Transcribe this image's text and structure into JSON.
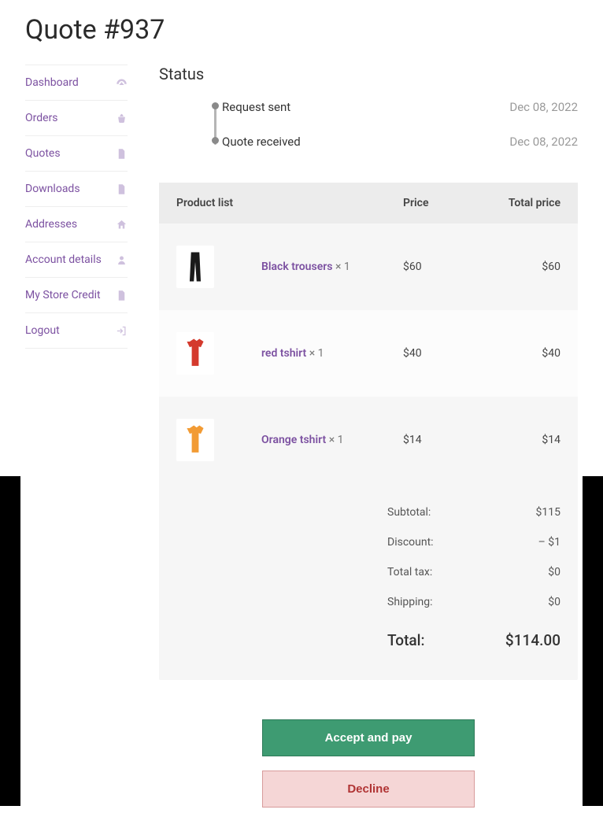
{
  "page_title": "Quote #937",
  "sidebar": {
    "items": [
      {
        "label": "Dashboard",
        "icon": "gauge-icon"
      },
      {
        "label": "Orders",
        "icon": "basket-icon"
      },
      {
        "label": "Quotes",
        "icon": "file-icon"
      },
      {
        "label": "Downloads",
        "icon": "file-icon"
      },
      {
        "label": "Addresses",
        "icon": "home-icon"
      },
      {
        "label": "Account details",
        "icon": "user-icon"
      },
      {
        "label": "My Store Credit",
        "icon": "file-icon"
      },
      {
        "label": "Logout",
        "icon": "logout-icon"
      }
    ]
  },
  "status": {
    "heading": "Status",
    "events": [
      {
        "label": "Request sent",
        "date": "Dec 08, 2022"
      },
      {
        "label": "Quote received",
        "date": "Dec 08, 2022"
      }
    ]
  },
  "products": {
    "headers": {
      "product": "Product list",
      "price": "Price",
      "total": "Total price"
    },
    "items": [
      {
        "name": "Black trousers",
        "qty": "× 1",
        "price": "$60",
        "total": "$60",
        "color": "#1a1a1a",
        "kind": "trousers"
      },
      {
        "name": "red tshirt",
        "qty": "× 1",
        "price": "$40",
        "total": "$40",
        "color": "#d43a2d",
        "kind": "tshirt"
      },
      {
        "name": "Orange tshirt",
        "qty": "× 1",
        "price": "$14",
        "total": "$14",
        "color": "#f29b34",
        "kind": "tshirt"
      }
    ]
  },
  "totals": {
    "rows": [
      {
        "label": "Subtotal:",
        "value": "$115"
      },
      {
        "label": "Discount:",
        "value": "– $1"
      },
      {
        "label": "Total tax:",
        "value": "$0"
      },
      {
        "label": "Shipping:",
        "value": "$0"
      }
    ],
    "grand": {
      "label": "Total:",
      "value": "$114.00"
    }
  },
  "actions": {
    "accept": "Accept and pay",
    "decline": "Decline"
  }
}
